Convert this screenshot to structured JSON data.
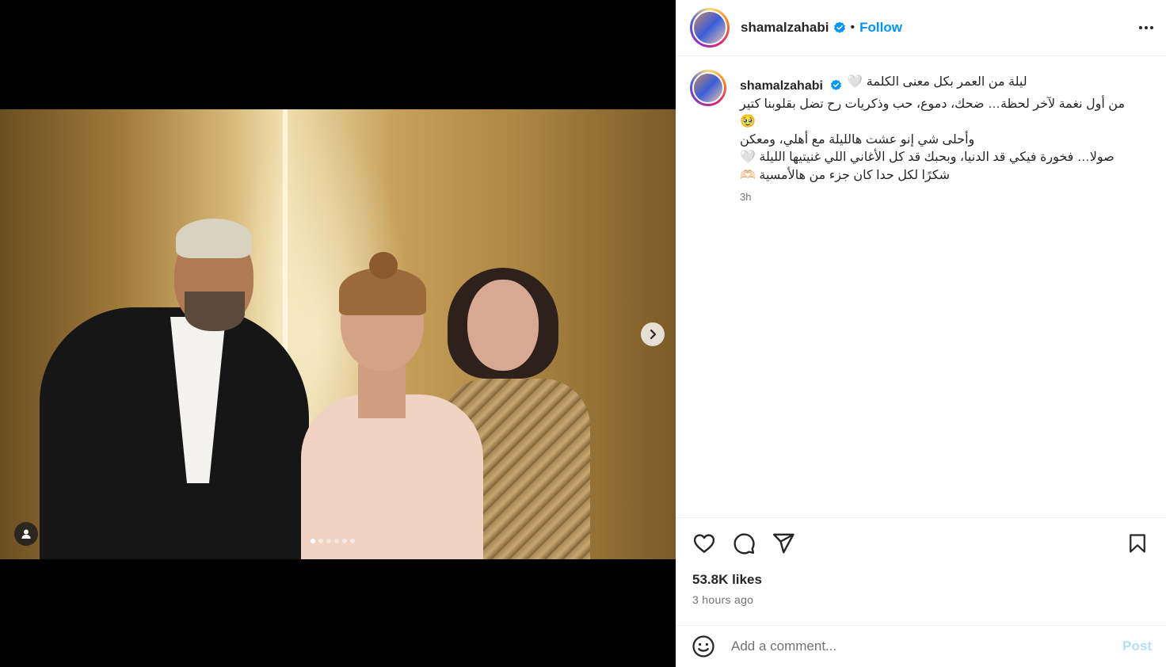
{
  "post": {
    "username": "shamalzahabi",
    "follow_label": "Follow",
    "separator": "•",
    "caption_lines": [
      "ليلة من العمر بكل معنى الكلمة 🤍",
      "من أول نغمة لآخر لحظة… ضحك، دموع، حب وذكريات رح تضل بقلوبنا كتير 🥹",
      "وأحلى شي إنو عشت هالليلة مع أهلي، ومعكن",
      "صولا… فخورة فيكي قد الدنيا، وبحبك قد كل الأغاني اللي غنيتيها الليلة 🤍",
      "شكرًا لكل حدا كان جزء من هالأمسية 🫶🏻"
    ],
    "time_short": "3h",
    "likes": "53.8K likes",
    "time_long": "3 hours ago"
  },
  "carousel": {
    "total": 6,
    "active_index": 0
  },
  "comment": {
    "placeholder": "Add a comment...",
    "post_label": "Post"
  },
  "icons": {
    "verified": "verified-badge-icon",
    "more": "more-options-icon",
    "like": "heart-icon",
    "comment": "comment-icon",
    "share": "share-icon",
    "save": "bookmark-icon",
    "emoji": "emoji-icon",
    "next": "chevron-right-icon",
    "tag": "user-tag-icon"
  },
  "colors": {
    "accent": "#0095f6",
    "verified": "#0095f6",
    "post_disabled": "#b2dffc",
    "muted": "#737373"
  }
}
